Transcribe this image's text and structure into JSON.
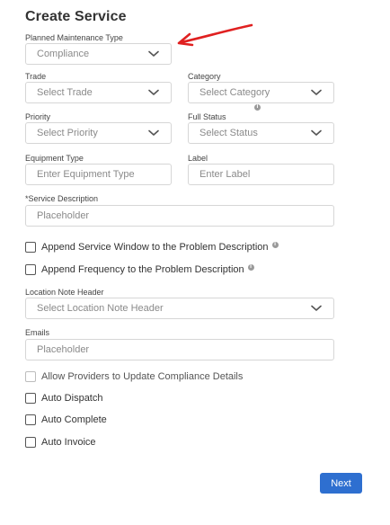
{
  "title": "Create Service",
  "planned_maintenance": {
    "label": "Planned Maintenance Type",
    "value": "Compliance"
  },
  "trade": {
    "label": "Trade",
    "placeholder": "Select Trade"
  },
  "category": {
    "label": "Category",
    "placeholder": "Select Category"
  },
  "priority": {
    "label": "Priority",
    "placeholder": "Select Priority"
  },
  "full_status": {
    "label": "Full Status",
    "placeholder": "Select Status"
  },
  "equipment_type": {
    "label": "Equipment Type",
    "placeholder": "Enter Equipment Type"
  },
  "label_field": {
    "label": "Label",
    "placeholder": "Enter Label"
  },
  "service_description": {
    "label": "*Service Description",
    "placeholder": "Placeholder"
  },
  "checkboxes_top": [
    {
      "label": "Append Service Window to the Problem Description",
      "checked": false
    },
    {
      "label": "Append Frequency to the Problem Description",
      "checked": false
    }
  ],
  "location_note_header": {
    "label": "Location Note Header",
    "placeholder": "Select Location Note Header"
  },
  "emails": {
    "label": "Emails",
    "placeholder": "Placeholder"
  },
  "checkboxes_bottom": [
    {
      "label": "Allow Providers to Update Compliance Details",
      "checked": false,
      "disabled": true
    },
    {
      "label": "Auto Dispatch",
      "checked": false
    },
    {
      "label": "Auto Complete",
      "checked": false
    },
    {
      "label": "Auto Invoice",
      "checked": false
    }
  ],
  "next_label": "Next",
  "info_glyph": "i",
  "colors": {
    "accent": "#2e6fd0",
    "annotation_arrow": "#e02020",
    "border": "#d6d6d6",
    "placeholder": "#8a8a8a"
  }
}
